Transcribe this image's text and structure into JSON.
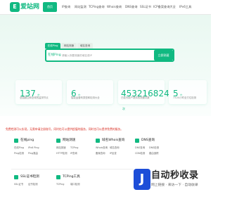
{
  "brand": {
    "logo_text": "E",
    "name": "爱站网"
  },
  "nav": [
    {
      "label": "首页",
      "active": true
    },
    {
      "label": "IP查询"
    },
    {
      "label": "网站监测"
    },
    {
      "label": "TCPing查询"
    },
    {
      "label": "Whois查询"
    },
    {
      "label": "DNS查询"
    },
    {
      "label": "SSL证书"
    },
    {
      "label": "ICP备案查询大全"
    },
    {
      "label": "IPv6工具"
    }
  ],
  "search": {
    "tabs": [
      {
        "label": "在线Ping",
        "active": true
      },
      {
        "label": "网站测速"
      },
      {
        "label": "域名查询"
      }
    ],
    "mode_label": "在线Ping",
    "placeholder": "请输入你要测速的域名或IP",
    "button": "立即测速"
  },
  "stats": [
    {
      "value": "137",
      "unit": "个",
      "label": "全国超过和全球的监测节点"
    },
    {
      "value": "6",
      "unit": "个",
      "label": "智能运营商类型和检测大全"
    },
    {
      "value": "453216824",
      "unit": "次",
      "label": "已经为用户提供的测速次数"
    },
    {
      "value": "5",
      "unit": "个",
      "label": "7×24小时全方位检测"
    }
  ],
  "notice": "免费检测可以实现，无需申请注册账号，同时也可以提供超值的服务，同时也可以提供免费的服务。",
  "tools": [
    {
      "title": "在线ping",
      "links": [
        "在线Ping",
        "IPv6 Ping",
        "Ping检测",
        "Ping路由"
      ]
    },
    {
      "title": "网站测速",
      "links": [
        "网站测速",
        "TCPing",
        "HTTP检测",
        "IP查询"
      ]
    },
    {
      "title": "域名Whois查询",
      "links": [
        "Whois查询",
        "域名查询",
        "备案查询",
        "IP反查"
      ]
    },
    {
      "title": "DNS查询",
      "links": [
        "DNS查询",
        "DNS检测",
        "CDN检测",
        "路由追踪"
      ]
    },
    {
      "title": "SSL证书检测",
      "links": [
        "SSL证书",
        "证书检测"
      ]
    },
    {
      "title": "TCPing工具",
      "links": [
        "TCPing",
        "端口检测"
      ]
    }
  ],
  "watermark": {
    "brand": "J",
    "title": "自动秒收录",
    "subtitle": "网上链接 · 来访一下 · 自动收录"
  },
  "colors": {
    "accent": "#10b981",
    "notice": "#d93025"
  }
}
